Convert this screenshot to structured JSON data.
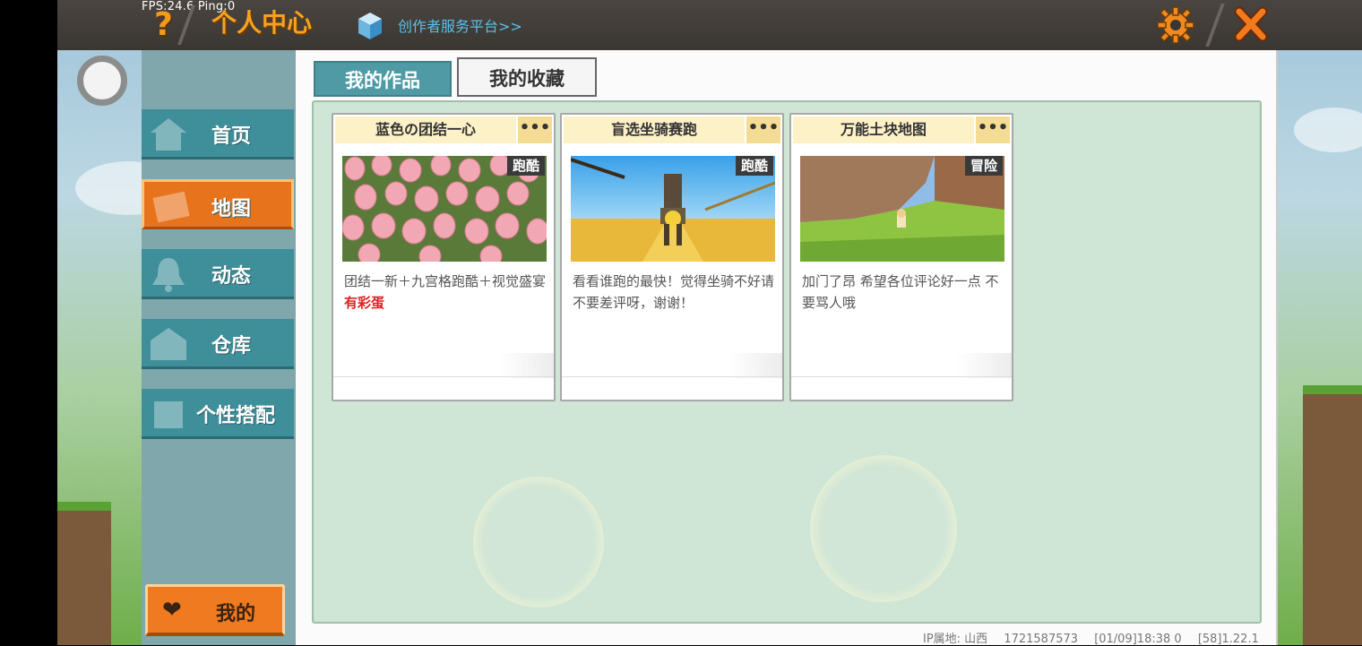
{
  "status": {
    "fps": "FPS:24.6",
    "ping": "Ping:0"
  },
  "header": {
    "title": "个人中心",
    "creator_link": "创作者服务平台>>"
  },
  "sidebar": {
    "items": [
      {
        "label": "首页"
      },
      {
        "label": "地图"
      },
      {
        "label": "动态"
      },
      {
        "label": "仓库"
      },
      {
        "label": "个性搭配"
      }
    ],
    "me_label": "我的",
    "active": "地图"
  },
  "tabs": [
    {
      "label": "我的作品"
    },
    {
      "label": "我的收藏"
    }
  ],
  "cards": [
    {
      "title": "蓝色の团结一心",
      "more": "•••",
      "tag": "跑酷",
      "desc": "团结一新＋九宫格跑酷＋视觉盛宴",
      "desc_highlight": "有彩蛋"
    },
    {
      "title": "盲选坐骑赛跑",
      "more": "•••",
      "tag": "跑酷",
      "desc": "看看谁跑的最快！觉得坐骑不好请不要差评呀，谢谢！",
      "desc_highlight": ""
    },
    {
      "title": "万能土块地图",
      "more": "•••",
      "tag": "冒险",
      "desc": "加门了昂 希望各位评论好一点 不要骂人哦",
      "desc_highlight": ""
    }
  ],
  "footer": {
    "ip": "IP属地: 山西",
    "uid": "1721587573",
    "time": "[01/09]18:38 0",
    "version": "[58]1.22.1"
  },
  "colors": {
    "accent": "#e8731d",
    "nav": "#3f8f9a",
    "content_bg": "#cfe5d5"
  }
}
